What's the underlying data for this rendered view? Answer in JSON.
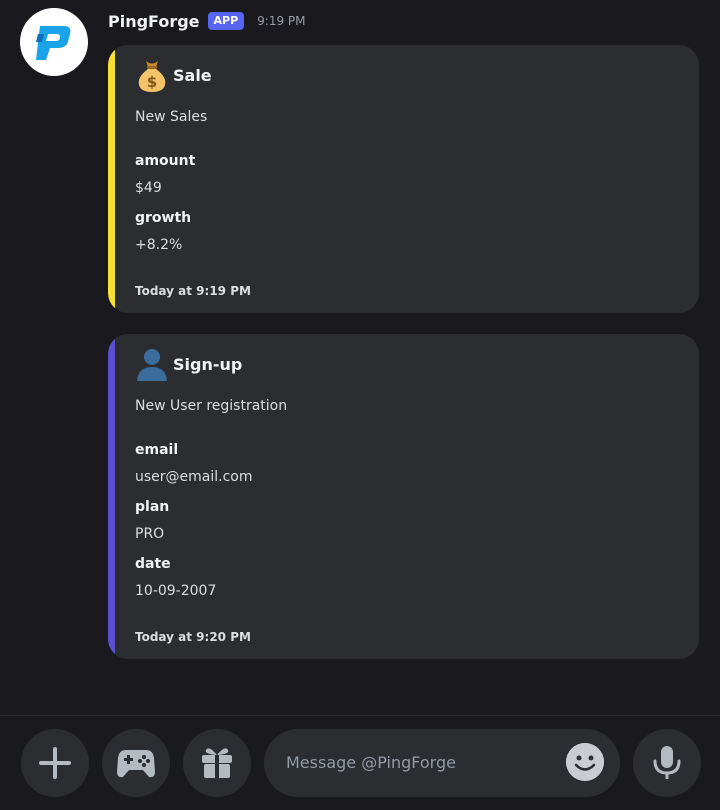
{
  "message": {
    "username": "PingForge",
    "badge": "APP",
    "time": "9:19 PM"
  },
  "embeds": [
    {
      "emoji": "money-bag-icon",
      "title": "Sale",
      "description": "New Sales",
      "accent": "#f5e033",
      "fields": [
        {
          "name": "amount",
          "value": "$49"
        },
        {
          "name": "growth",
          "value": "+8.2%"
        }
      ],
      "footer": "Today at 9:19 PM"
    },
    {
      "emoji": "user-silhouette-icon",
      "title": "Sign-up",
      "description": "New User registration",
      "accent": "#5b4fd1",
      "fields": [
        {
          "name": "email",
          "value": "user@email.com"
        },
        {
          "name": "plan",
          "value": "PRO"
        },
        {
          "name": "date",
          "value": "10-09-2007"
        }
      ],
      "footer": "Today at 9:20 PM"
    }
  ],
  "composer": {
    "placeholder": "Message @PingForge",
    "buttons": [
      "plus-icon",
      "gamepad-icon",
      "gift-icon",
      "emoji-icon",
      "microphone-icon"
    ]
  },
  "colors": {
    "background": "#1a1a1e",
    "surface": "#2b2d31",
    "brand": "#5865f2",
    "logo": "#1aa3e8"
  }
}
